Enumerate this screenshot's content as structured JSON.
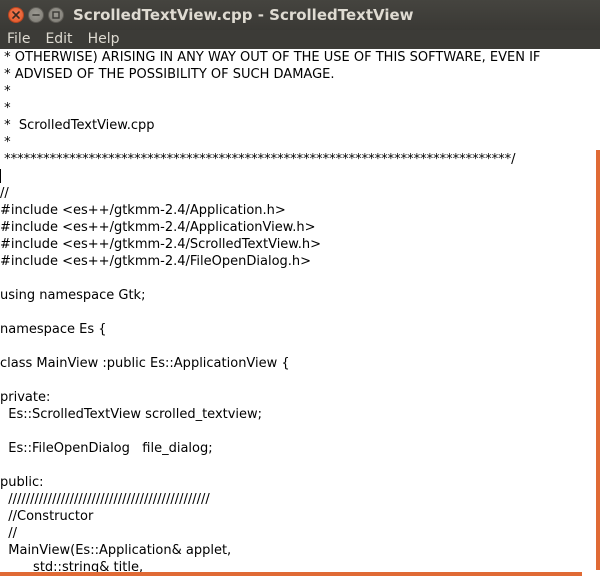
{
  "window": {
    "title": "ScrolledTextView.cpp - ScrolledTextView"
  },
  "menu": [
    "File",
    "Edit",
    "Help"
  ],
  "icons": {
    "close": "close-icon",
    "minimize": "minimize-icon",
    "maximize": "maximize-icon"
  },
  "colors": {
    "titlebar": "#3c3b37",
    "close_button": "#e95420",
    "scroll_indicator": "#e06a35"
  },
  "editor": {
    "lines": [
      " * OTHERWISE) ARISING IN ANY WAY OUT OF THE USE OF THIS SOFTWARE, EVEN IF",
      " * ADVISED OF THE POSSIBILITY OF SUCH DAMAGE.",
      " *",
      " *",
      " *  ScrolledTextView.cpp",
      " *",
      " ******************************************************************************/",
      "",
      "//",
      "#include <es++/gtkmm-2.4/Application.h>",
      "#include <es++/gtkmm-2.4/ApplicationView.h>",
      "#include <es++/gtkmm-2.4/ScrolledTextView.h>",
      "#include <es++/gtkmm-2.4/FileOpenDialog.h>",
      "",
      "using namespace Gtk;",
      "",
      "namespace Es {",
      "",
      "class MainView :public Es::ApplicationView {",
      "",
      "private:",
      "  Es::ScrolledTextView scrolled_textview;",
      "",
      "  Es::FileOpenDialog   file_dialog;",
      "",
      "public:",
      "  //////////////////////////////////////////////",
      "  //Constructor",
      "  //",
      "  MainView(Es::Application& applet,",
      "        std::string& title,"
    ]
  }
}
